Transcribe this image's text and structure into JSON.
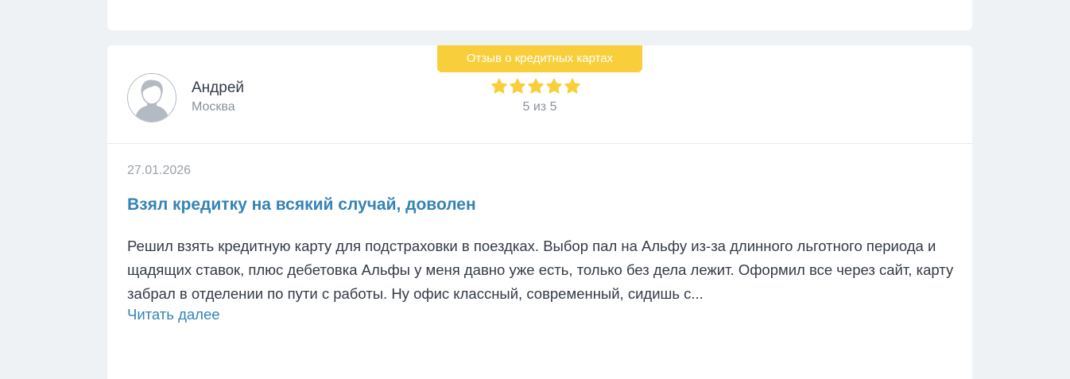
{
  "review": {
    "badge": "Отзыв о кредитных картах",
    "author": {
      "name": "Андрей",
      "city": "Москва"
    },
    "rating": {
      "value": 5,
      "max": 5,
      "text": "5 из 5",
      "star_color": "#f8cf3a"
    },
    "date": "27.01.2026",
    "title": "Взял кредитку на всякий случай, доволен",
    "text": "Решил взять кредитную карту для подстраховки в поездках. Выбор пал на Альфу из-за длинного льготного периода и щадящих ставок, плюс дебетовка Альфы у меня давно уже есть, только без дела лежит. Оформил все через сайт, карту забрал в отделении по пути с работы. Ну офис классный, современный, сидишь с...",
    "read_more": "Читать далее"
  },
  "colors": {
    "accent": "#3483b6",
    "badge": "#f8cf3a",
    "background": "#eff2f5"
  }
}
